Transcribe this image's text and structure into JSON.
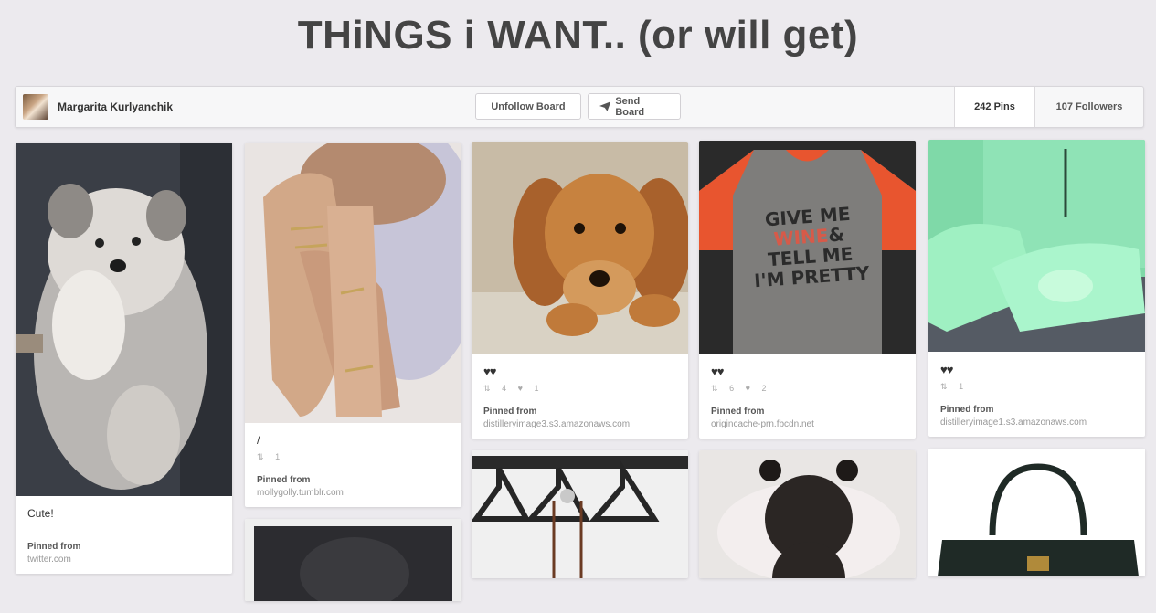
{
  "board": {
    "title": "THiNGS i WANT.. (or will get)"
  },
  "header": {
    "owner_name": "Margarita Kurlyanchik",
    "unfollow_label": "Unfollow Board",
    "send_label": "Send Board",
    "pins_count": "242 Pins",
    "followers_count": "107 Followers"
  },
  "pins": [
    {
      "description": "Cute!",
      "pinned_from_label": "Pinned from",
      "source": "twitter.com"
    },
    {
      "description": "/",
      "repins": "1",
      "pinned_from_label": "Pinned from",
      "source": "mollygolly.tumblr.com"
    },
    {
      "description": "♥♥",
      "repins": "4",
      "likes": "1",
      "pinned_from_label": "Pinned from",
      "source": "distilleryimage3.s3.amazonaws.com"
    },
    {
      "description": "♥♥",
      "repins": "6",
      "likes": "2",
      "pinned_from_label": "Pinned from",
      "source": "origincache-prn.fbcdn.net",
      "shirt_text": [
        "GIVE ME",
        "WINE",
        "&",
        "TELL ME",
        "I'M PRETTY"
      ]
    },
    {
      "description": "♥♥",
      "repins": "1",
      "pinned_from_label": "Pinned from",
      "source": "distilleryimage1.s3.amazonaws.com"
    }
  ],
  "icons": {
    "send": "paper-plane-icon",
    "repin": "repin-icon",
    "like": "heart-icon"
  },
  "colors": {
    "background": "#eceaee",
    "shirt_accent": "#d75a49"
  }
}
